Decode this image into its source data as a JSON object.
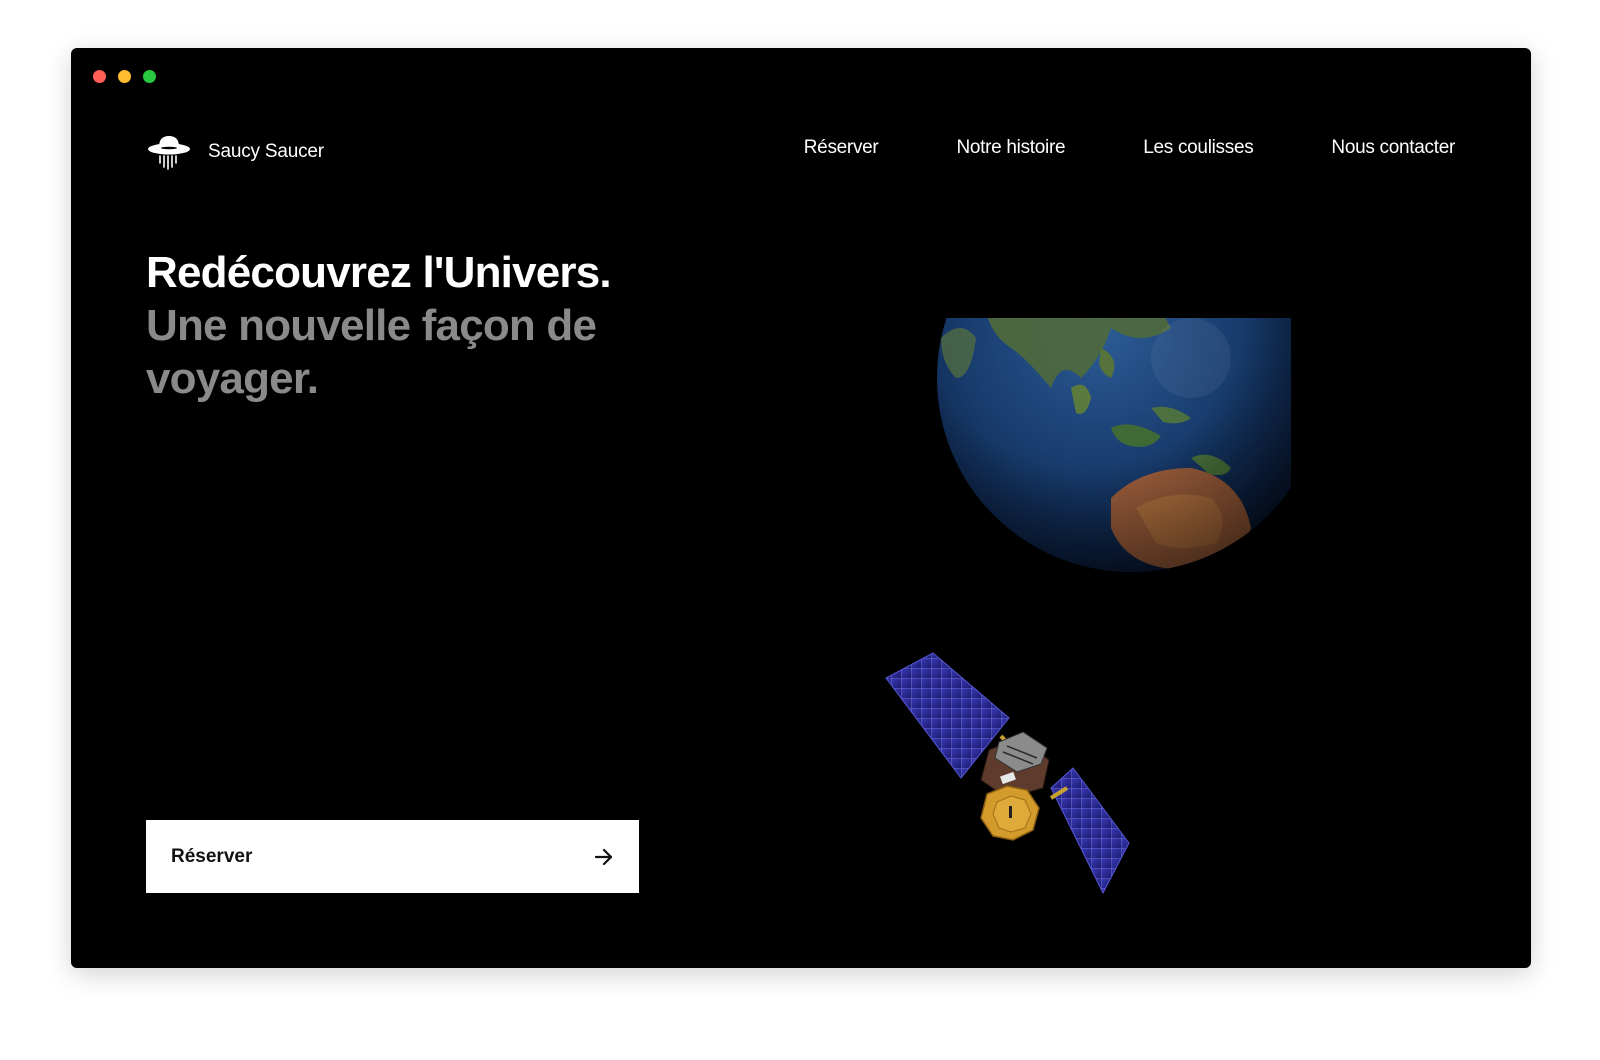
{
  "window": {
    "controls": [
      "close",
      "minimize",
      "zoom"
    ],
    "control_colors": {
      "close": "#ff5f57",
      "minimize": "#febc2e",
      "zoom": "#28c840"
    },
    "background": "#000000"
  },
  "brand": {
    "name": "Saucy Saucer",
    "icon": "ufo-icon"
  },
  "nav": {
    "items": [
      {
        "label": "Réserver"
      },
      {
        "label": "Notre histoire"
      },
      {
        "label": "Les coulisses"
      },
      {
        "label": "Nous contacter"
      }
    ]
  },
  "hero": {
    "title": "Redécouvrez l'Univers.",
    "subtitle": "Une nouvelle façon de voyager.",
    "title_color": "#ffffff",
    "subtitle_color": "#8a8a8a"
  },
  "cta": {
    "label": "Réserver",
    "icon": "arrow-right-icon"
  },
  "illustration": {
    "earth": "earth-globe-image",
    "satellite": "satellite-image"
  }
}
